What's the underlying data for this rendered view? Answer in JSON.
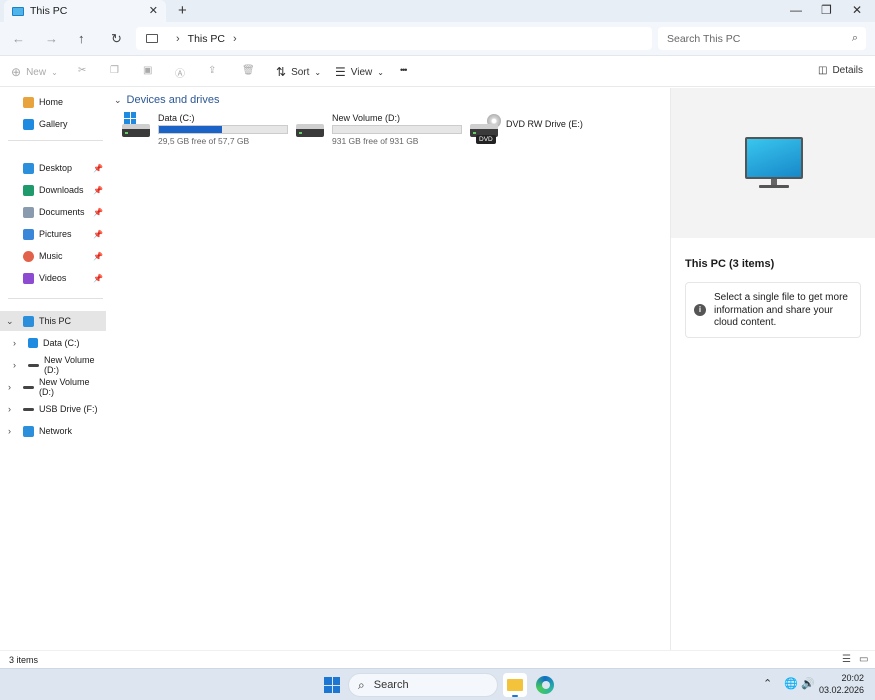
{
  "window": {
    "tab_title": "This PC",
    "tab_close": "✕",
    "new_tab": "+",
    "controls": {
      "minimize": "—",
      "maximize": "❐",
      "close": "✕"
    }
  },
  "nav": {
    "back": "←",
    "forward": "→",
    "up": "↑",
    "refresh": "↻",
    "breadcrumb": [
      "This PC"
    ],
    "search_placeholder": "Search This PC"
  },
  "toolbar": {
    "new_label": "New",
    "sort_label": "Sort",
    "view_label": "View",
    "more_label": "•••",
    "details_label": "Details",
    "icons": [
      "cut-icon",
      "copy-icon",
      "paste-icon",
      "rename-icon",
      "share-icon",
      "delete-icon"
    ]
  },
  "sidebar": {
    "quick": [
      {
        "label": "Home",
        "icon": "home-icon",
        "color": "#e8a33d"
      },
      {
        "label": "Gallery",
        "icon": "gallery-icon",
        "color": "#1e8be0"
      }
    ],
    "pinned": [
      {
        "label": "Desktop",
        "icon": "desktop-icon",
        "color": "#2b8fdc"
      },
      {
        "label": "Downloads",
        "icon": "downloads-icon",
        "color": "#1f9a6d"
      },
      {
        "label": "Documents",
        "icon": "documents-icon",
        "color": "#8a9bb0"
      },
      {
        "label": "Pictures",
        "icon": "pictures-icon",
        "color": "#3a87d9"
      },
      {
        "label": "Music",
        "icon": "music-icon",
        "color": "#e2614a"
      },
      {
        "label": "Videos",
        "icon": "videos-icon",
        "color": "#8d4bd1"
      }
    ],
    "tree": [
      {
        "label": "This PC",
        "icon": "this-pc-icon",
        "selected": true,
        "expanded": true,
        "indent": 0
      },
      {
        "label": "Data (C:)",
        "icon": "drive-c-icon",
        "indent": 1
      },
      {
        "label": "New Volume (D:)",
        "icon": "drive-d-icon",
        "indent": 1
      },
      {
        "label": "New Volume (D:)",
        "icon": "drive-d-icon",
        "indent": 0
      },
      {
        "label": "USB Drive (F:)",
        "icon": "usb-drive-icon",
        "indent": 0
      },
      {
        "label": "Network",
        "icon": "network-icon",
        "indent": 0
      }
    ]
  },
  "main": {
    "group_title": "Devices and drives",
    "drives": [
      {
        "name": "Data (C:)",
        "free_text": "29,5 GB free of 57,7 GB",
        "used_fraction": 0.49,
        "bar_color": "#1c63c7",
        "icon": "windows-drive-icon"
      },
      {
        "name": "New Volume (D:)",
        "free_text": "931 GB free of 931 GB",
        "used_fraction": 0.0,
        "bar_color": "#1c63c7",
        "icon": "hdd-icon"
      },
      {
        "name": "DVD RW Drive (E:)",
        "badge": "DVD",
        "icon": "dvd-drive-icon"
      }
    ]
  },
  "details": {
    "title": "This PC (3 items)",
    "info_text": "Select a single file to get more information and share your cloud content."
  },
  "status": {
    "count": "3 items"
  },
  "taskbar": {
    "search_label": "Search",
    "time": "20:02",
    "date": "03.02.2026"
  }
}
